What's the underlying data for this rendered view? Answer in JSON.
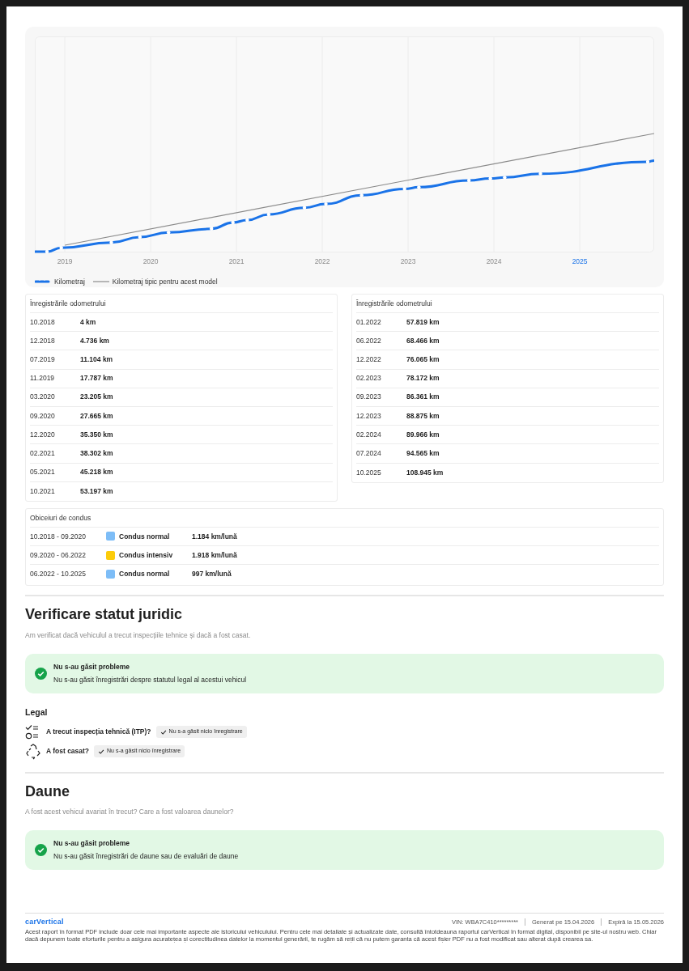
{
  "mileage_chart": {
    "x_labels": [
      {
        "label": "2019",
        "highlighted": false
      },
      {
        "label": "2020",
        "highlighted": false
      },
      {
        "label": "2021",
        "highlighted": false
      },
      {
        "label": "2022",
        "highlighted": false
      },
      {
        "label": "2023",
        "highlighted": false
      },
      {
        "label": "2024",
        "highlighted": false
      },
      {
        "label": "2025",
        "highlighted": true
      }
    ],
    "legend": [
      {
        "kind": "dotted",
        "label": "Kilometraj"
      },
      {
        "kind": "solid",
        "label": "Kilometraj tipic pentru acest model"
      }
    ]
  },
  "odometer_tables": [
    {
      "title": "Înregistrările odometrului",
      "rows": [
        {
          "date": "10.2018",
          "km": "4 km"
        },
        {
          "date": "12.2018",
          "km": "4.736 km"
        },
        {
          "date": "07.2019",
          "km": "11.104 km"
        },
        {
          "date": "11.2019",
          "km": "17.787 km"
        },
        {
          "date": "03.2020",
          "km": "23.205 km"
        },
        {
          "date": "09.2020",
          "km": "27.665 km"
        },
        {
          "date": "12.2020",
          "km": "35.350 km"
        },
        {
          "date": "02.2021",
          "km": "38.302 km"
        },
        {
          "date": "05.2021",
          "km": "45.218 km"
        },
        {
          "date": "10.2021",
          "km": "53.197 km"
        }
      ]
    },
    {
      "title": "Înregistrările odometrului",
      "rows": [
        {
          "date": "01.2022",
          "km": "57.819 km"
        },
        {
          "date": "06.2022",
          "km": "68.466 km"
        },
        {
          "date": "12.2022",
          "km": "76.065 km"
        },
        {
          "date": "02.2023",
          "km": "78.172 km"
        },
        {
          "date": "09.2023",
          "km": "86.361 km"
        },
        {
          "date": "12.2023",
          "km": "88.875 km"
        },
        {
          "date": "02.2024",
          "km": "89.966 km"
        },
        {
          "date": "07.2024",
          "km": "94.565 km"
        },
        {
          "date": "10.2025",
          "km": "108.945 km"
        }
      ]
    }
  ],
  "driving_habits": {
    "title": "Obiceiuri de condus",
    "rows": [
      {
        "period": "10.2018 - 09.2020",
        "color": "#7dbdf7",
        "style": "Condus normal",
        "rate": "1.184 km/lună"
      },
      {
        "period": "09.2020 - 06.2022",
        "color": "#fccc0a",
        "style": "Condus intensiv",
        "rate": "1.918 km/lună"
      },
      {
        "period": "06.2022 - 10.2025",
        "color": "#7dbdf7",
        "style": "Condus normal",
        "rate": "997 km/lună"
      }
    ]
  },
  "sections": [
    {
      "title": "Verificare statut juridic",
      "subtitle": "Am verificat dacă vehiculul a trecut inspecțiile tehnice și dacă a fost casat.",
      "alert": {
        "title": "Nu s-au găsit probleme",
        "text": "Nu s-au găsit înregistrări despre statutul legal al acestui vehicul"
      },
      "group": {
        "title": "Legal",
        "items": [
          {
            "kind": "inspection",
            "label": "A trecut inspecția tehnică (ITP)?",
            "status": "Nu s-a găsit nicio înregistrare"
          },
          {
            "kind": "scrapped",
            "label": "A fost casat?",
            "status": "Nu s-a găsit nicio înregistrare"
          }
        ]
      }
    },
    {
      "title": "Daune",
      "subtitle": "A fost acest vehicul avariat în trecut? Care a fost valoarea daunelor?",
      "alert": {
        "title": "Nu s-au găsit probleme",
        "text": "Nu s-au găsit înregistrări de daune sau de evaluări de daune"
      }
    }
  ],
  "footer": {
    "logo": "carVertical",
    "meta": [
      "VIN: WBA7C410*********",
      "Generat pe 15.04.2026",
      "Expiră la 15.05.2026"
    ],
    "disclaimer": "Acest raport în format PDF include doar cele mai importante aspecte ale istoricului vehiculului. Pentru cele mai detaliate și actualizate date, consultă întotdeauna raportul carVertical în format digital, disponibil pe site-ul nostru web. Chiar dacă depunem toate eforturile pentru a asigura acuratețea și corectitudinea datelor la momentul generării, te rugăm să reții că nu putem garanta că acest fișier PDF nu a fost modificat sau alterat după crearea sa."
  }
}
